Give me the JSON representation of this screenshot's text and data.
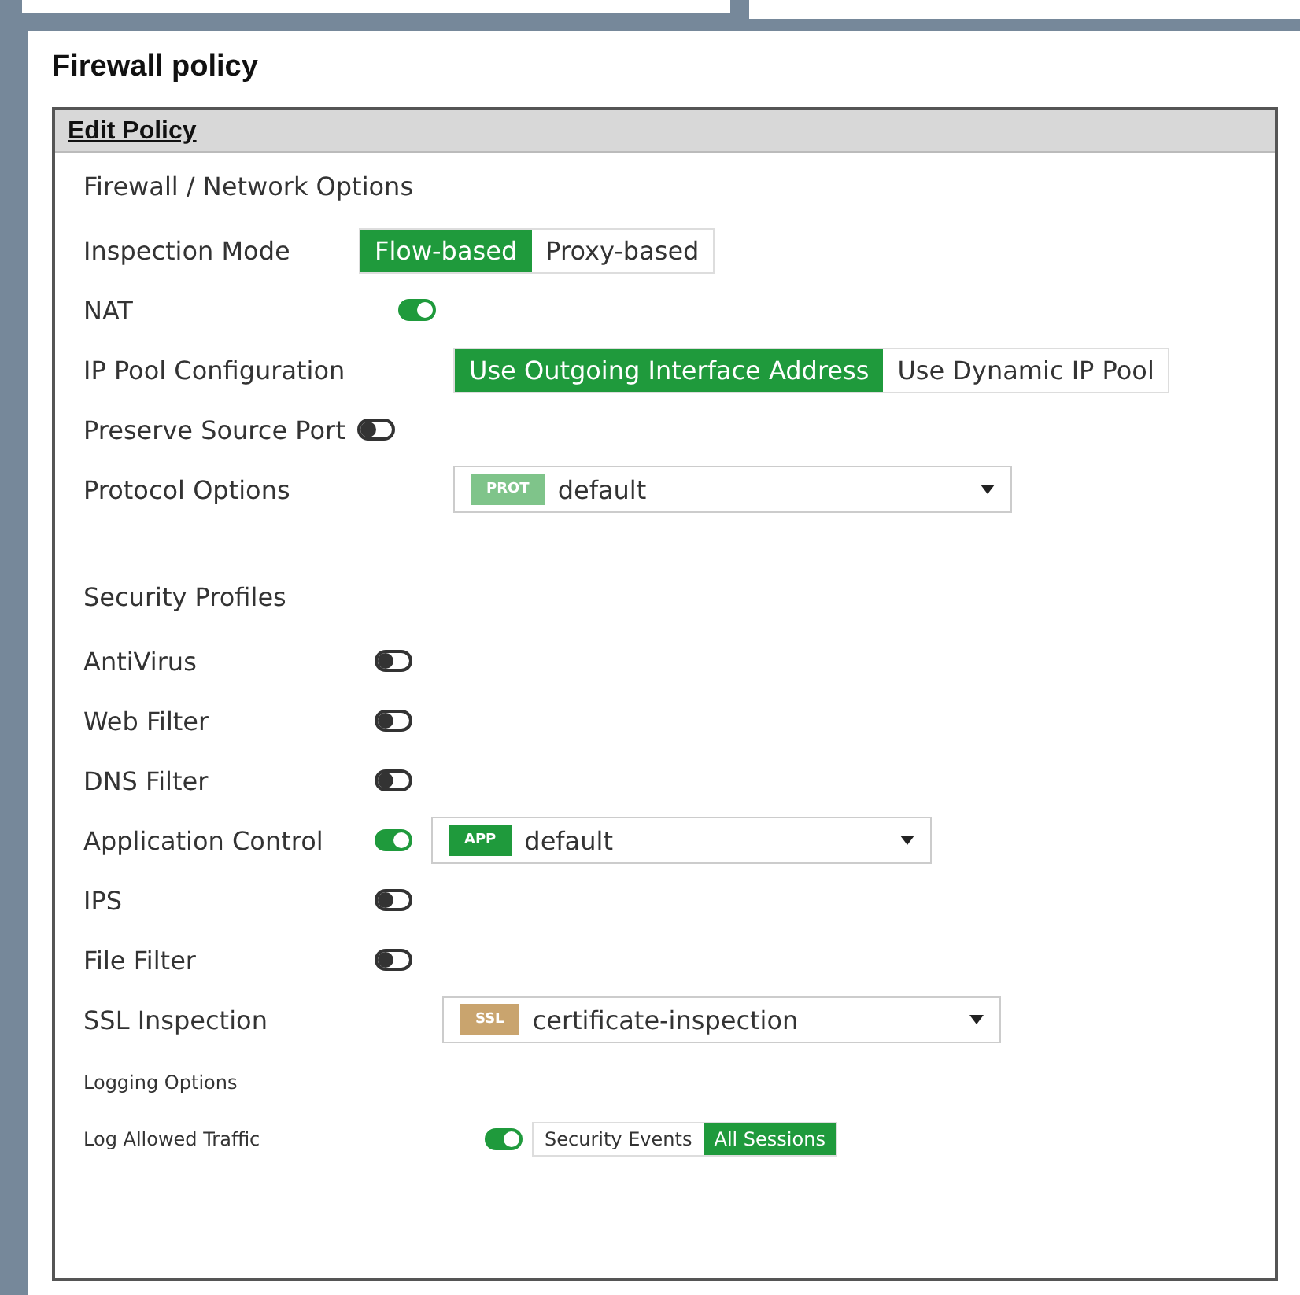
{
  "page_title": "Firewall policy",
  "panel": {
    "title": "Edit Policy",
    "sections": [
      {
        "title": "Firewall / Network Options",
        "rows": [
          {
            "kind": "segmented",
            "label": "Inspection Mode",
            "options": [
              {
                "label": "Flow-based",
                "selected": true
              },
              {
                "label": "Proxy-based",
                "selected": false
              }
            ]
          },
          {
            "kind": "toggle",
            "label": "NAT",
            "on": true
          },
          {
            "kind": "segmented",
            "label": "IP Pool Configuration",
            "options": [
              {
                "label": "Use Outgoing Interface Address",
                "selected": true
              },
              {
                "label": "Use Dynamic IP Pool",
                "selected": false
              }
            ]
          },
          {
            "kind": "toggle",
            "label": "Preserve Source Port",
            "on": false
          },
          {
            "kind": "select",
            "label": "Protocol Options",
            "tag": "PROT",
            "color": "#7fc48a",
            "value": "default"
          }
        ]
      },
      {
        "title": "Security Profiles",
        "rows": [
          {
            "kind": "toggle",
            "label": "AntiVirus",
            "on": false
          },
          {
            "kind": "toggle",
            "label": "Web Filter",
            "on": false
          },
          {
            "kind": "toggle",
            "label": "DNS Filter",
            "on": false
          },
          {
            "kind": "toggle",
            "label": "Application Control",
            "on": true,
            "select": {
              "tag": "APP",
              "color": "#1f9a3c",
              "value": "default"
            }
          },
          {
            "kind": "toggle",
            "label": "IPS",
            "on": false
          },
          {
            "kind": "toggle",
            "label": "File Filter",
            "on": false
          },
          {
            "kind": "select",
            "label": "SSL Inspection",
            "tag": "SSL",
            "color": "#c9a46e",
            "value": "certificate-inspection"
          }
        ]
      },
      {
        "title": "Logging Options",
        "rows": [
          {
            "kind": "toggle",
            "label": "Log Allowed Traffic",
            "on": true,
            "options": [
              {
                "label": "Security Events",
                "selected": false
              },
              {
                "label": "All Sessions",
                "selected": true
              }
            ]
          }
        ]
      }
    ]
  }
}
